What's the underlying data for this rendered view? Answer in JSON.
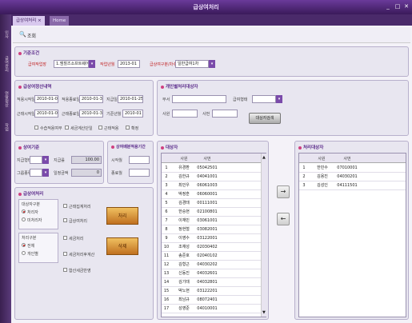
{
  "window": {
    "title": "급상여처리"
  },
  "leftbar": {
    "items": [
      "인사",
      "급여관리",
      "연말정산",
      "작업"
    ]
  },
  "tabs": [
    {
      "label": "급상여처리"
    },
    {
      "label": "Home"
    }
  ],
  "toolbar": {
    "search_label": "조회"
  },
  "basic": {
    "title": "기준조건",
    "company_label": "급여작업장",
    "company_value": "1.엠힐즈소프트웨어",
    "month_label": "작업년월",
    "month_value": "2013-01",
    "type_label": "급상여구분/차수",
    "type_value": "일반급여1차"
  },
  "info": {
    "title": "급상여정산내역",
    "start_label": "적용시작일",
    "start_value": "2010-01-01",
    "end_label": "적용종료일",
    "end_value": "2010-01-31",
    "pay_label": "지급일",
    "pay_value": "2010-01-25",
    "base_label": "근태시작일",
    "base_value": "2010-01-01",
    "work_end_label": "근태종료일",
    "work_end_value": "2010-01-31",
    "std_label": "기준년월",
    "std_value": "2010-01",
    "chk1": "수습적용여부",
    "chk2": "세금계산단일",
    "chk3": "근태적용",
    "chk4": "확정"
  },
  "person": {
    "title": "개인별처리대상자",
    "dept_label": "부서",
    "grade_label": "급여형태",
    "emp_label": "사원",
    "job_label": "사번",
    "button_label": "대상자검색"
  },
  "criteria": {
    "title": "상여기준",
    "pay_label": "지급형태",
    "rate_label": "지급률",
    "rate_value": "100.00",
    "group_label": "그룹종류",
    "period_label": "일정금액",
    "period_value": "0"
  },
  "period": {
    "title": "상여배분적용기간",
    "start_label": "시작월",
    "end_label": "종료월"
  },
  "process": {
    "title": "급상여처리",
    "target_label": "대상자구분",
    "target_opts": [
      "처리자",
      "미처리자"
    ],
    "proc_label": "처리구분",
    "proc_opts": [
      "전체",
      "개인별"
    ],
    "chk_a": "근태집계처리",
    "chk_b": "급상여처리",
    "chk_c": "세금처리",
    "chk_d": "세금처리후계산",
    "chk_e": "합산세금반영",
    "process_btn": "처리",
    "delete_btn": "삭제"
  },
  "targets": {
    "title": "대상자",
    "headers": [
      "사원",
      "사번"
    ],
    "rows": [
      [
        "유경환",
        "05042501"
      ],
      [
        "김한규",
        "04041001"
      ],
      [
        "최민우",
        "06061003"
      ],
      [
        "박정훈",
        "06060001"
      ],
      [
        "김경태",
        "00111001"
      ],
      [
        "한승현",
        "02100801"
      ],
      [
        "이재민",
        "03061001"
      ],
      [
        "정현철",
        "03082001"
      ],
      [
        "이영수",
        "03122001"
      ],
      [
        "조재성",
        "02030402"
      ],
      [
        "송준호",
        "02040102"
      ],
      [
        "김형근",
        "04030202"
      ],
      [
        "신동진",
        "04032601"
      ],
      [
        "김기태",
        "04032801"
      ],
      [
        "박노현",
        "03122201"
      ],
      [
        "최남규",
        "08072401"
      ],
      [
        "성영준",
        "04010001"
      ]
    ]
  },
  "processed": {
    "title": "처리대상자",
    "headers": [
      "사원",
      "사번"
    ],
    "rows": [
      [
        "한민수",
        "07010001"
      ],
      [
        "김용진",
        "04030201"
      ],
      [
        "김성인",
        "04111501"
      ]
    ]
  },
  "arrows": {
    "right": "→",
    "left": "←"
  }
}
